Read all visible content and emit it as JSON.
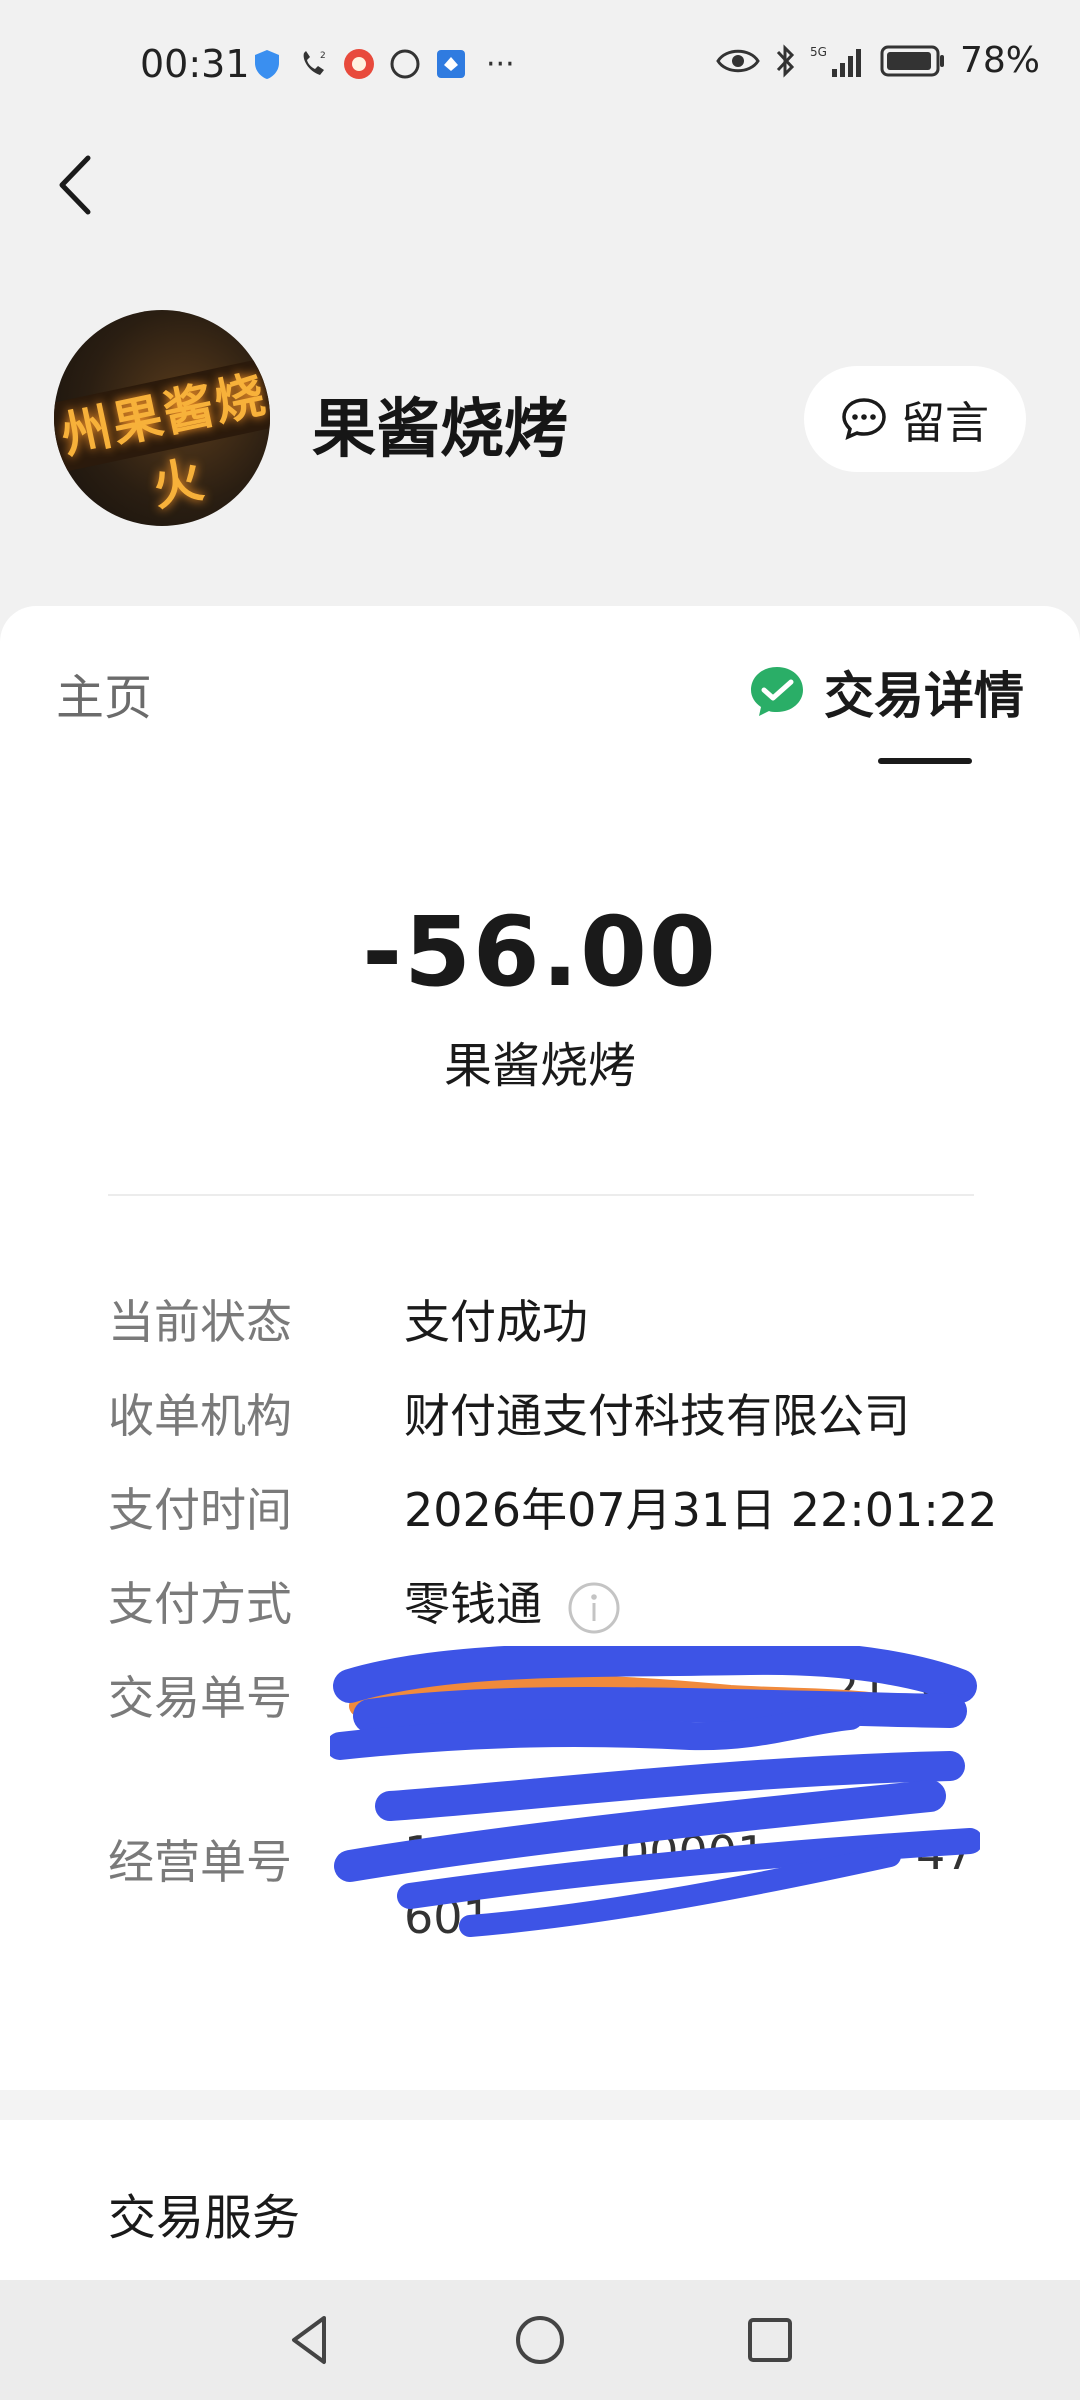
{
  "status_bar": {
    "time": "00:31",
    "battery": "78%",
    "network": "5G",
    "more": "···"
  },
  "header": {
    "merchant_name": "果酱烧烤",
    "avatar_sign_text": "州果酱烧火",
    "message_button_label": "留言"
  },
  "tabs": {
    "home": "主页",
    "detail": "交易详情"
  },
  "transaction": {
    "amount": "-56.00",
    "merchant": "果酱烧烤"
  },
  "details": [
    {
      "label": "当前状态",
      "value": "支付成功"
    },
    {
      "label": "收单机构",
      "value": "财付通支付科技有限公司"
    },
    {
      "label": "支付时间",
      "value": "2026年07月31日 22:01:22"
    },
    {
      "label": "支付方式",
      "value": "零钱通"
    },
    {
      "label": "交易单号",
      "value": ""
    },
    {
      "label": "经营单号",
      "value": ""
    }
  ],
  "redacted_fragments": {
    "order_tail": "21 3",
    "biz_head": "1",
    "biz_mid": "00001",
    "biz_tail": "47",
    "biz_line2": "601"
  },
  "services": {
    "title": "交易服务"
  },
  "colors": {
    "wechat_green": "#2aae67",
    "scribble_blue": "#3d54e6",
    "scribble_orange": "#f08a3c"
  }
}
